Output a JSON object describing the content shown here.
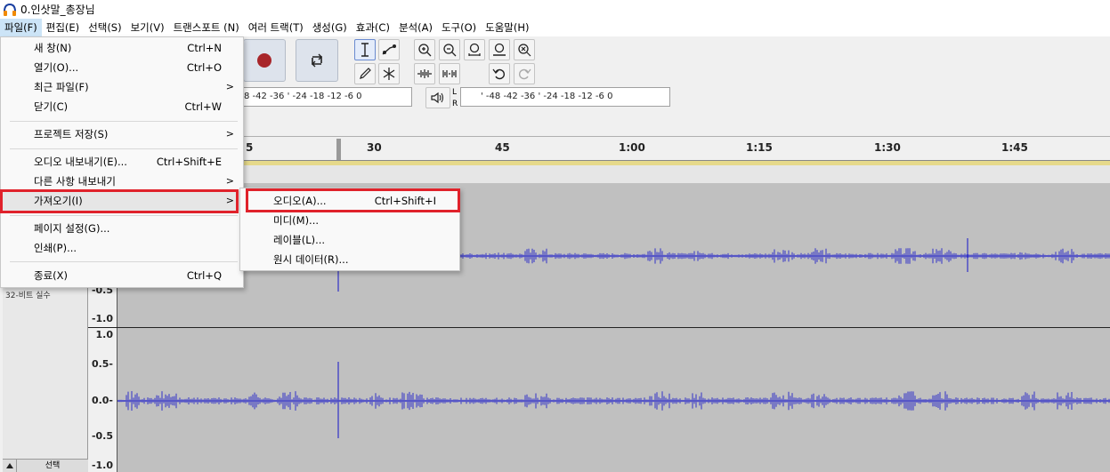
{
  "window": {
    "title": "0.인삿말_총장님"
  },
  "menubar": {
    "items": [
      "파일(F)",
      "편집(E)",
      "선택(S)",
      "보기(V)",
      "트랜스포트 (N)",
      "여러 트랙(T)",
      "생성(G)",
      "효과(C)",
      "분석(A)",
      "도구(O)",
      "도움말(H)"
    ]
  },
  "file_menu": {
    "new": {
      "label": "새 창(N)",
      "shortcut": "Ctrl+N"
    },
    "open": {
      "label": "열기(O)...",
      "shortcut": "Ctrl+O"
    },
    "recent": {
      "label": "최근 파일(F)",
      "submenu": ">"
    },
    "close": {
      "label": "닫기(C)",
      "shortcut": "Ctrl+W"
    },
    "save_project": {
      "label": "프로젝트 저장(S)",
      "submenu": ">"
    },
    "export_audio": {
      "label": "오디오 내보내기(E)...",
      "shortcut": "Ctrl+Shift+E"
    },
    "export_other": {
      "label": "다른 사항 내보내기",
      "submenu": ">"
    },
    "import": {
      "label": "가져오기(I)",
      "submenu": ">"
    },
    "page_setup": {
      "label": "페이지 설정(G)..."
    },
    "print": {
      "label": "인쇄(P)..."
    },
    "exit": {
      "label": "종료(X)",
      "shortcut": "Ctrl+Q"
    }
  },
  "import_submenu": {
    "audio": {
      "label": "오디오(A)...",
      "shortcut": "Ctrl+Shift+I"
    },
    "midi": {
      "label": "미디(M)..."
    },
    "labels": {
      "label": "레이블(L)..."
    },
    "raw": {
      "label": "원시 데이터(R)..."
    }
  },
  "meters": {
    "record_scale": "8 -42 -36   '   -24 -18 -12  -6  0",
    "play_lr_top": "L",
    "play_lr_bottom": "R",
    "play_scale": "'    -48 -42 -36   '   -24 -18 -12  -6  0"
  },
  "timeline": {
    "ticks": [
      "5",
      "30",
      "45",
      "1:00",
      "1:15",
      "1:30",
      "1:45"
    ]
  },
  "track": {
    "format": "32-비트 실수",
    "select_label": "선택",
    "upper_channel_labels": [
      "-0.5",
      "-1.0"
    ],
    "lower_channel_labels": [
      "1.0",
      "0.5-",
      "0.0-",
      "-0.5",
      "-1.0"
    ]
  },
  "colors": {
    "waveform": "#3232c8",
    "highlight_box": "#e0222b",
    "wave_bg": "#c0c0c0"
  }
}
